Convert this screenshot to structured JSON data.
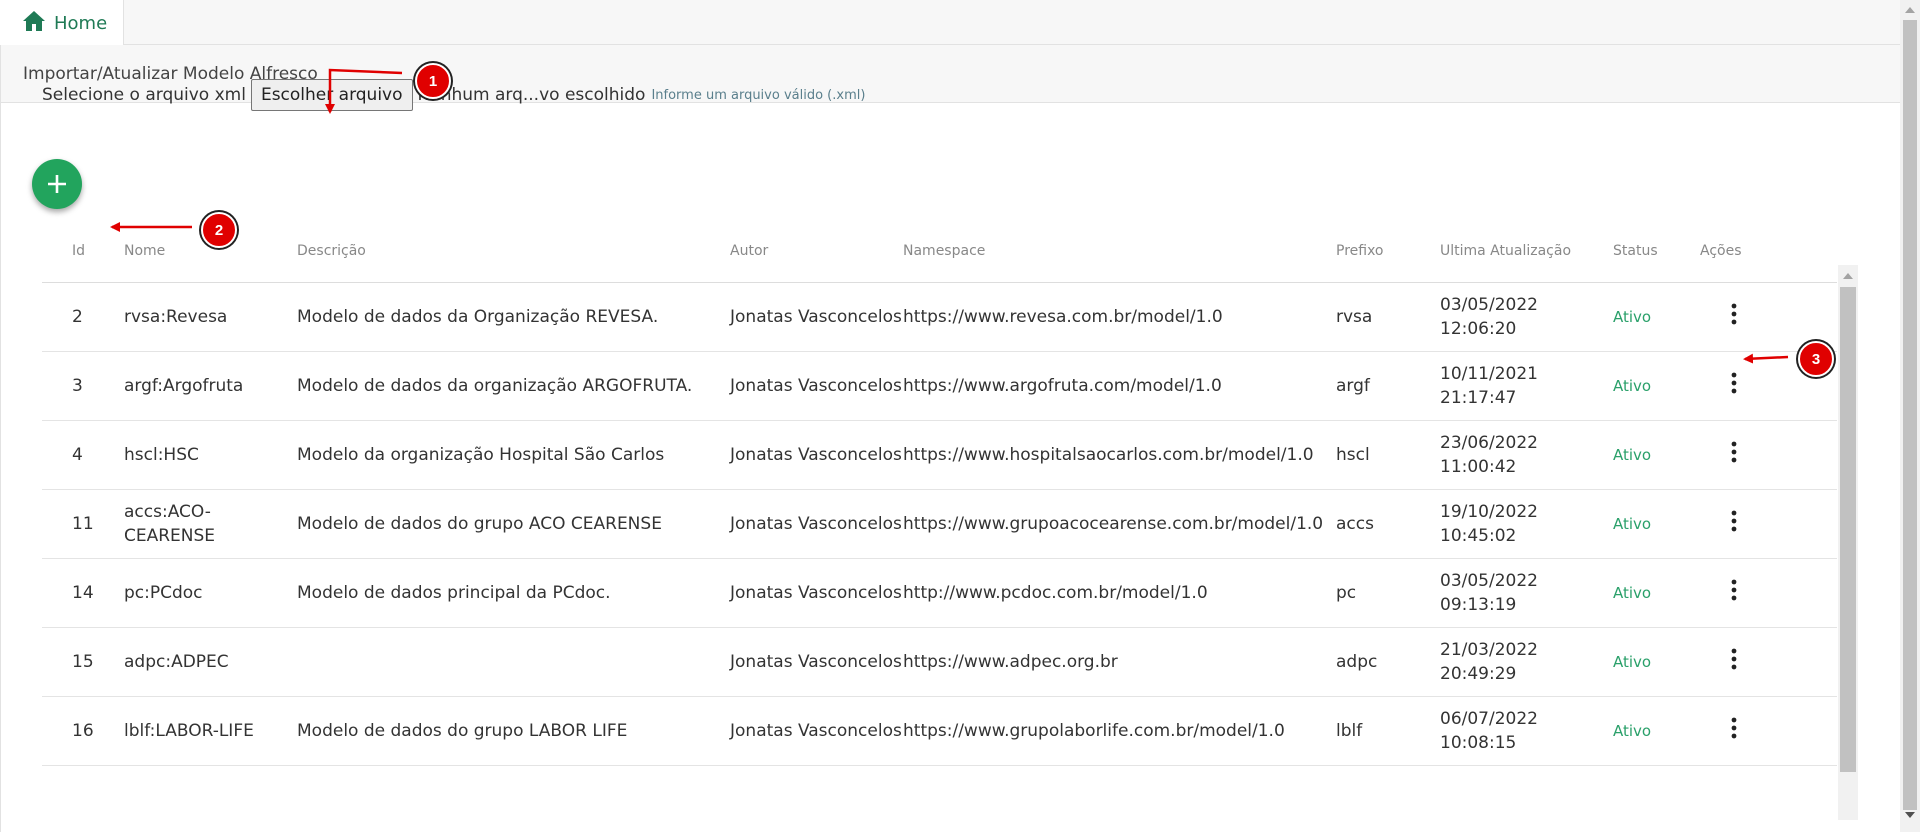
{
  "tab": {
    "label": "Home"
  },
  "panel": {
    "title": "Importar/Atualizar Modelo Alfresco"
  },
  "file_input": {
    "label": "Selecione o arquivo xml",
    "button_label": "Escolher arquivo",
    "status_text": "Nenhum arq...vo escolhido",
    "hint": "Informe um arquivo válido (.xml)"
  },
  "table": {
    "headers": {
      "id": "Id",
      "nome": "Nome",
      "descricao": "Descrição",
      "autor": "Autor",
      "namespace": "Namespace",
      "prefixo": "Prefixo",
      "ultima": "Ultima Atualização",
      "status": "Status",
      "acoes": "Ações"
    },
    "rows": [
      {
        "id": "2",
        "nome": "rvsa:Revesa",
        "descricao": "Modelo de dados da Organização REVESA.",
        "autor": "Jonatas Vasconcelos",
        "namespace": "https://www.revesa.com.br/model/1.0",
        "prefixo": "rvsa",
        "data": "03/05/2022",
        "hora": "12:06:20",
        "status": "Ativo"
      },
      {
        "id": "3",
        "nome": "argf:Argofruta",
        "descricao": "Modelo de dados da organização ARGOFRUTA.",
        "autor": "Jonatas Vasconcelos",
        "namespace": "https://www.argofruta.com/model/1.0",
        "prefixo": "argf",
        "data": "10/11/2021",
        "hora": "21:17:47",
        "status": "Ativo"
      },
      {
        "id": "4",
        "nome": "hscl:HSC",
        "descricao": "Modelo da organização Hospital São Carlos",
        "autor": "Jonatas Vasconcelos",
        "namespace": "https://www.hospitalsaocarlos.com.br/model/1.0",
        "prefixo": "hscl",
        "data": "23/06/2022",
        "hora": "11:00:42",
        "status": "Ativo"
      },
      {
        "id": "11",
        "nome": "accs:ACO-CEARENSE",
        "descricao": "Modelo de dados do grupo ACO CEARENSE",
        "autor": "Jonatas Vasconcelos",
        "namespace": "https://www.grupoacocearense.com.br/model/1.0",
        "prefixo": "accs",
        "data": "19/10/2022",
        "hora": "10:45:02",
        "status": "Ativo"
      },
      {
        "id": "14",
        "nome": "pc:PCdoc",
        "descricao": "Modelo de dados principal da PCdoc.",
        "autor": "Jonatas Vasconcelos",
        "namespace": "http://www.pcdoc.com.br/model/1.0",
        "prefixo": "pc",
        "data": "03/05/2022",
        "hora": "09:13:19",
        "status": "Ativo"
      },
      {
        "id": "15",
        "nome": "adpc:ADPEC",
        "descricao": "",
        "autor": "Jonatas Vasconcelos",
        "namespace": "https://www.adpec.org.br",
        "prefixo": "adpc",
        "data": "21/03/2022",
        "hora": "20:49:29",
        "status": "Ativo"
      },
      {
        "id": "16",
        "nome": "lblf:LABOR-LIFE",
        "descricao": "Modelo de dados do grupo LABOR LIFE",
        "autor": "Jonatas Vasconcelos",
        "namespace": "https://www.grupolaborlife.com.br/model/1.0",
        "prefixo": "lblf",
        "data": "06/07/2022",
        "hora": "10:08:15",
        "status": "Ativo"
      }
    ]
  },
  "annotations": [
    "1",
    "2",
    "3"
  ],
  "colors": {
    "accent": "#22a45d",
    "status": "#2aa06a",
    "home": "#1f7a55",
    "annotation": "#e00000"
  }
}
